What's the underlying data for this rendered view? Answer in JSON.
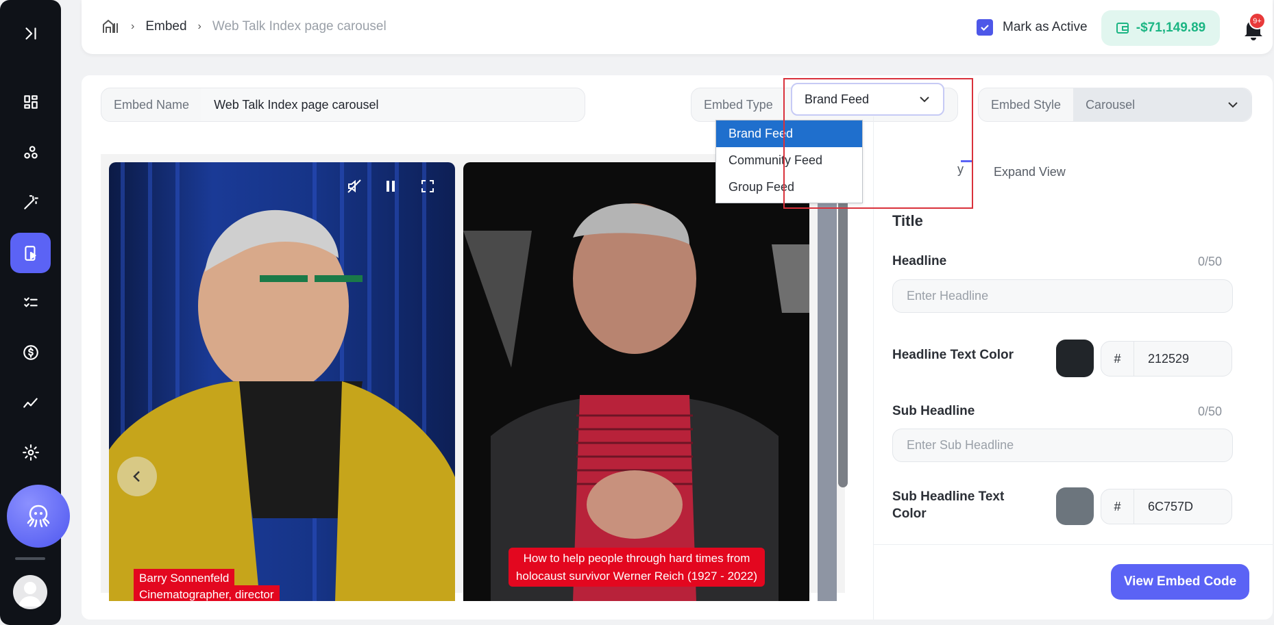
{
  "breadcrumb": {
    "home_icon": "home-icon",
    "embed": "Embed",
    "current": "Web Talk Index page carousel"
  },
  "header": {
    "mark_active_label": "Mark as Active",
    "mark_active_checked": true,
    "wallet_balance": "-$71,149.89",
    "notification_badge": "9+"
  },
  "sidebar": {
    "items": [
      "expand-icon",
      "dashboard-icon",
      "connections-icon",
      "magic-wand-icon",
      "video-embed-icon",
      "checklist-icon",
      "dollar-icon",
      "analytics-icon",
      "settings-icon"
    ],
    "active": "video-embed-icon"
  },
  "form": {
    "embed_name_label": "Embed Name",
    "embed_name_value": "Web Talk Index page carousel",
    "embed_type_label": "Embed Type",
    "embed_type_value": "Brand Feed",
    "embed_type_options": [
      "Brand Feed",
      "Community Feed",
      "Group Feed"
    ],
    "embed_style_label": "Embed Style",
    "embed_style_value": "Carousel"
  },
  "preview": {
    "card1_caption_line1": "Barry Sonnenfeld",
    "card1_caption_line2": "Cinematographer, director",
    "card2_caption_line1": "How to help people through hard times from",
    "card2_caption_line2": "holocaust survivor Werner Reich (1927 - 2022)"
  },
  "panel": {
    "tab_partial": "y",
    "tab_expand": "Expand View",
    "section_title": "Title",
    "headline_label": "Headline",
    "headline_count": "0/50",
    "headline_placeholder": "Enter Headline",
    "headline_color_label": "Headline Text Color",
    "headline_color_hash": "#",
    "headline_color_value": "212529",
    "sub_headline_label": "Sub Headline",
    "sub_headline_count": "0/50",
    "sub_headline_placeholder": "Enter Sub Headline",
    "sub_color_label_line1": "Sub Headline Text",
    "sub_color_label_line2": "Color",
    "sub_color_hash": "#",
    "sub_color_value": "6C757D",
    "view_code_button": "View Embed Code"
  },
  "colors": {
    "accent": "#5b63f5",
    "headline_swatch": "#212529",
    "sub_swatch": "#6C757D",
    "wallet_text": "#1bb583"
  }
}
